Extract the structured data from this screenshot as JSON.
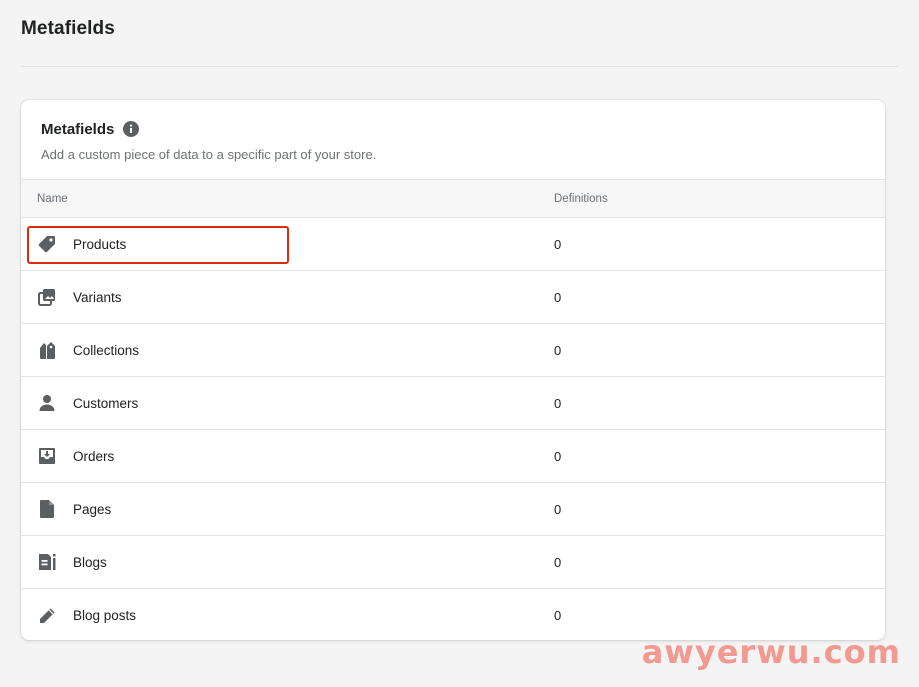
{
  "page": {
    "title": "Metafields"
  },
  "card": {
    "title": "Metafields",
    "info_icon": "info-icon",
    "subtitle": "Add a custom piece of data to a specific part of your store."
  },
  "table": {
    "columns": {
      "name": "Name",
      "definitions": "Definitions"
    },
    "rows": [
      {
        "label": "Products",
        "definitions": "0",
        "icon": "tag-icon",
        "highlighted": true
      },
      {
        "label": "Variants",
        "definitions": "0",
        "icon": "variants-icon",
        "highlighted": false
      },
      {
        "label": "Collections",
        "definitions": "0",
        "icon": "collections-icon",
        "highlighted": false
      },
      {
        "label": "Customers",
        "definitions": "0",
        "icon": "customer-icon",
        "highlighted": false
      },
      {
        "label": "Orders",
        "definitions": "0",
        "icon": "orders-icon",
        "highlighted": false
      },
      {
        "label": "Pages",
        "definitions": "0",
        "icon": "page-icon",
        "highlighted": false
      },
      {
        "label": "Blogs",
        "definitions": "0",
        "icon": "blogs-icon",
        "highlighted": false
      },
      {
        "label": "Blog posts",
        "definitions": "0",
        "icon": "pencil-icon",
        "highlighted": false
      }
    ]
  },
  "watermark": {
    "text": "awyerwu.com"
  },
  "colors": {
    "highlight": "#d82c0d",
    "icon": "#5c5f62",
    "watermark": "#f28b82"
  }
}
